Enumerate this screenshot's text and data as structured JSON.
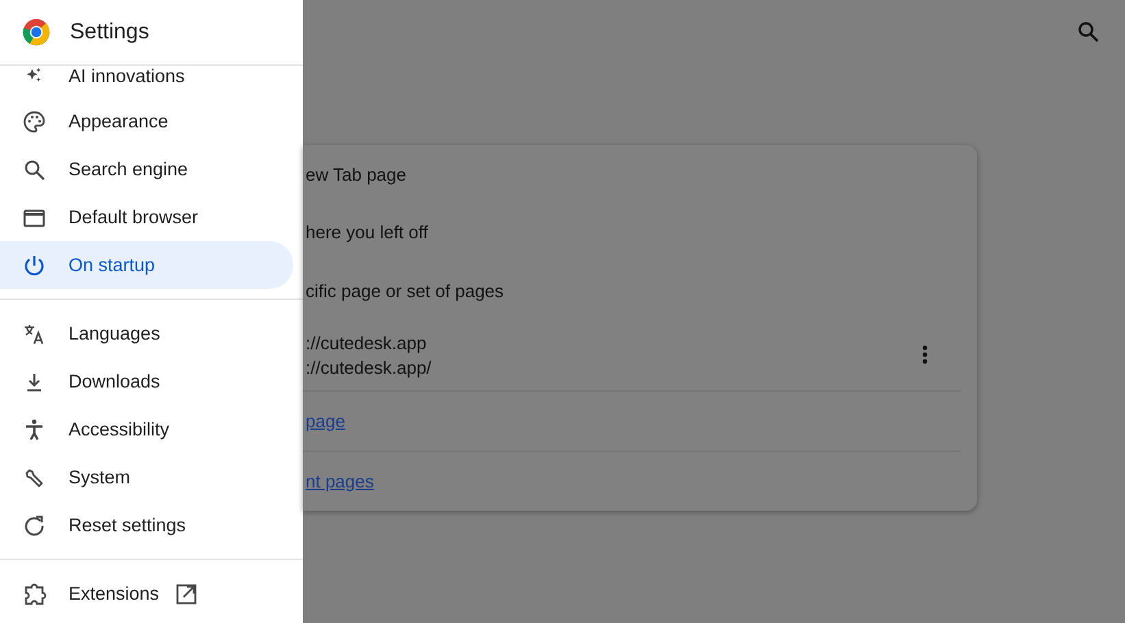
{
  "sidebar": {
    "title": "Settings",
    "groups": [
      {
        "items": [
          {
            "label": "AI innovations",
            "selected": false
          },
          {
            "label": "Appearance",
            "selected": false
          },
          {
            "label": "Search engine",
            "selected": false
          },
          {
            "label": "Default browser",
            "selected": false
          },
          {
            "label": "On startup",
            "selected": true
          }
        ]
      },
      {
        "items": [
          {
            "label": "Languages",
            "selected": false
          },
          {
            "label": "Downloads",
            "selected": false
          },
          {
            "label": "Accessibility",
            "selected": false
          },
          {
            "label": "System",
            "selected": false
          },
          {
            "label": "Reset settings",
            "selected": false
          }
        ]
      },
      {
        "items": [
          {
            "label": "Extensions",
            "selected": false,
            "external": true
          }
        ]
      }
    ]
  },
  "startup_card": {
    "options": [
      "ew Tab page",
      "here you left off",
      "cific page or set of pages"
    ],
    "page": {
      "name": "://cutedesk.app",
      "url": "://cutedesk.app/"
    },
    "links": [
      "page",
      "nt pages"
    ]
  }
}
